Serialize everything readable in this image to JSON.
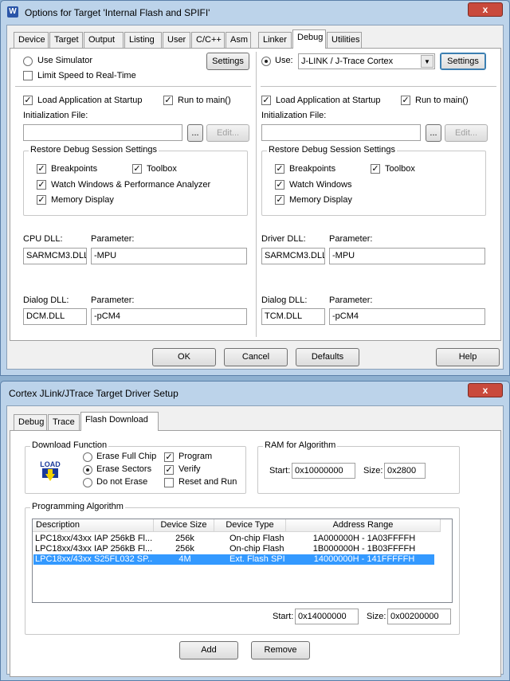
{
  "window1": {
    "title": "Options for Target 'Internal Flash and SPIFI'",
    "close_label": "x",
    "title_icon": "W",
    "tabs": [
      "Device",
      "Target",
      "Output",
      "Listing",
      "User",
      "C/C++",
      "Asm",
      "Linker",
      "Debug",
      "Utilities"
    ],
    "active_tab": "Debug",
    "left": {
      "use_simulator": "Use Simulator",
      "limit_speed": "Limit Speed to Real-Time",
      "settings": "Settings",
      "load_app": "Load Application at Startup",
      "run_to_main": "Run to main()",
      "init_file_label": "Initialization File:",
      "init_file_value": "",
      "browse": "...",
      "edit": "Edit...",
      "restore_group": "Restore Debug Session Settings",
      "breakpoints": "Breakpoints",
      "toolbox": "Toolbox",
      "watch": "Watch Windows & Performance Analyzer",
      "memory": "Memory Display",
      "dll_label": "CPU DLL:",
      "dll_param_label": "Parameter:",
      "dll_value": "SARMCM3.DLL",
      "dll_param": "-MPU",
      "dialog_label": "Dialog DLL:",
      "dialog_param_label": "Parameter:",
      "dialog_value": "DCM.DLL",
      "dialog_param": "-pCM4"
    },
    "right": {
      "use": "Use:",
      "driver": "J-LINK / J-Trace Cortex",
      "settings": "Settings",
      "load_app": "Load Application at Startup",
      "run_to_main": "Run to main()",
      "init_file_label": "Initialization File:",
      "init_file_value": "",
      "browse": "...",
      "edit": "Edit...",
      "restore_group": "Restore Debug Session Settings",
      "breakpoints": "Breakpoints",
      "toolbox": "Toolbox",
      "watch": "Watch Windows",
      "memory": "Memory Display",
      "dll_label": "Driver DLL:",
      "dll_param_label": "Parameter:",
      "dll_value": "SARMCM3.DLL",
      "dll_param": "-MPU",
      "dialog_label": "Dialog DLL:",
      "dialog_param_label": "Parameter:",
      "dialog_value": "TCM.DLL",
      "dialog_param": "-pCM4"
    },
    "buttons": {
      "ok": "OK",
      "cancel": "Cancel",
      "defaults": "Defaults",
      "help": "Help"
    }
  },
  "window2": {
    "title": "Cortex JLink/JTrace Target Driver Setup",
    "close_label": "x",
    "tabs": [
      "Debug",
      "Trace",
      "Flash Download"
    ],
    "active_tab": "Flash Download",
    "download_group": "Download Function",
    "load_icon_text": "LOAD",
    "erase_full": "Erase Full Chip",
    "erase_sectors": "Erase Sectors",
    "do_not_erase": "Do not Erase",
    "program": "Program",
    "verify": "Verify",
    "reset_run": "Reset and Run",
    "ram_group": "RAM for Algorithm",
    "ram_start_label": "Start:",
    "ram_start": "0x10000000",
    "ram_size_label": "Size:",
    "ram_size": "0x2800",
    "prog_group": "Programming Algorithm",
    "columns": [
      "Description",
      "Device Size",
      "Device Type",
      "Address Range"
    ],
    "rows": [
      [
        "LPC18xx/43xx IAP 256kB Fl...",
        "256k",
        "On-chip Flash",
        "1A000000H - 1A03FFFFH"
      ],
      [
        "LPC18xx/43xx IAP 256kB Fl...",
        "256k",
        "On-chip Flash",
        "1B000000H - 1B03FFFFH"
      ],
      [
        "LPC18xx/43xx S25FL032 SP...",
        "4M",
        "Ext. Flash SPI",
        "14000000H - 141FFFFFH"
      ]
    ],
    "selected_row": 2,
    "alg_start_label": "Start:",
    "alg_start": "0x14000000",
    "alg_size_label": "Size:",
    "alg_size": "0x00200000",
    "add": "Add",
    "remove": "Remove"
  }
}
